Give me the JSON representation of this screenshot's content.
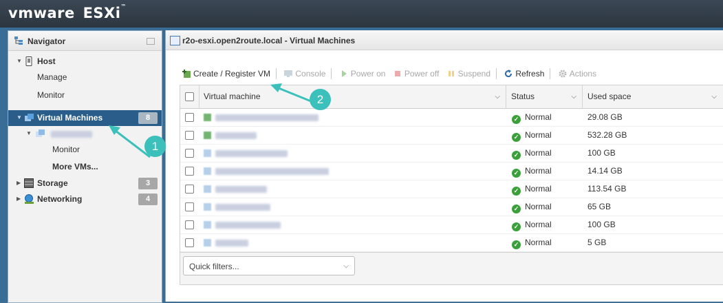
{
  "brand": {
    "vm": "vm",
    "ware": "ware",
    "product": "ESXi",
    "tm": "™"
  },
  "navigator": {
    "title": "Navigator",
    "host": {
      "label": "Host",
      "children": [
        "Manage",
        "Monitor"
      ]
    },
    "vms": {
      "label": "Virtual Machines",
      "count": "8",
      "children": [
        "Monitor",
        "More VMs..."
      ]
    },
    "storage": {
      "label": "Storage",
      "count": "3"
    },
    "networking": {
      "label": "Networking",
      "count": "4"
    }
  },
  "main": {
    "title": "r2o-esxi.open2route.local - Virtual Machines",
    "toolbar": {
      "create": "Create / Register VM",
      "console": "Console",
      "power_on": "Power on",
      "power_off": "Power off",
      "suspend": "Suspend",
      "refresh": "Refresh",
      "actions": "Actions"
    },
    "columns": {
      "vm": "Virtual machine",
      "status": "Status",
      "used": "Used space"
    },
    "rows": [
      {
        "status": "Normal",
        "used": "29.08 GB",
        "on": true
      },
      {
        "status": "Normal",
        "used": "532.28 GB",
        "on": true
      },
      {
        "status": "Normal",
        "used": "100 GB",
        "on": false
      },
      {
        "status": "Normal",
        "used": "14.14 GB",
        "on": false
      },
      {
        "status": "Normal",
        "used": "113.54 GB",
        "on": false
      },
      {
        "status": "Normal",
        "used": "65 GB",
        "on": false
      },
      {
        "status": "Normal",
        "used": "100 GB",
        "on": false
      },
      {
        "status": "Normal",
        "used": "5 GB",
        "on": false
      }
    ],
    "quick_filters": "Quick filters..."
  },
  "callouts": [
    "1",
    "2"
  ],
  "colors": {
    "accent": "#3cc0bb",
    "selected": "#2a5d8a",
    "ok": "#3aa03a"
  }
}
